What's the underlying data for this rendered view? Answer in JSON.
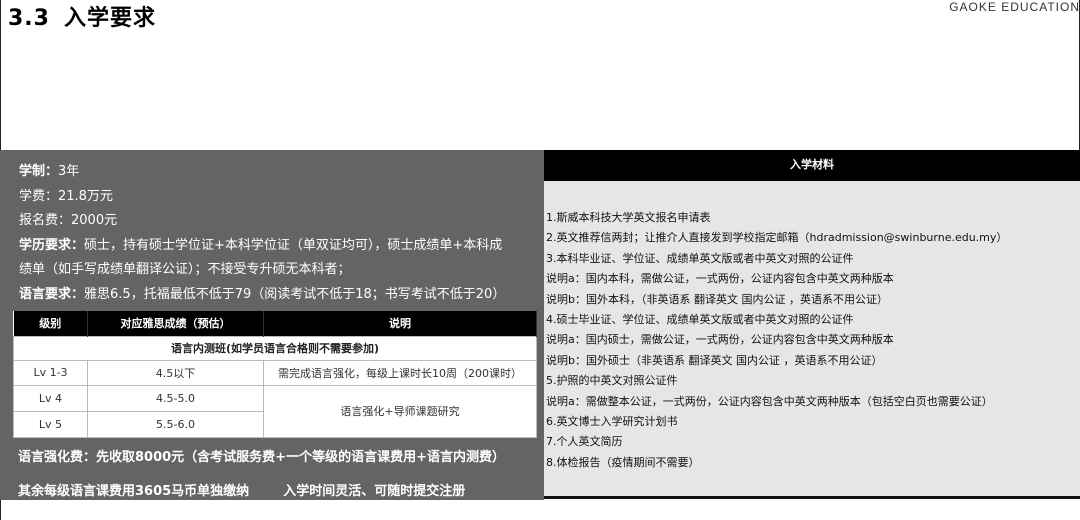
{
  "header": {
    "section_number": "3.3",
    "section_title": "入学要求",
    "brand": "GAOKE EDUCATION"
  },
  "left": {
    "duration_label": "学制：",
    "duration_value": "3年",
    "tuition": "学费：21.8万元",
    "application_fee": "报名费：2000元",
    "education_label": "学历要求：",
    "education_value_1": "硕士，持有硕士学位证+本科学位证（单双证均可），硕士成绩单+本科成",
    "education_value_2": "绩单（如手写成绩单翻译公证）；不接受专升硕无本科者；",
    "language_label": "语言要求：",
    "language_value": "雅思6.5，托福最低不低于79（阅读考试不低于18；书写考试不低于20）",
    "fee_line": "语言强化费：先收取8000元（含考试服务费+一个等级的语言课费用+语言内测费）",
    "other_fee": "其余每级语言课费用3605马币单独缴纳",
    "entry_time": "入学时间灵活、可随时提交注册"
  },
  "lang_table": {
    "caption": "语言内测班(如学员语言合格则不需要参加)",
    "headers": [
      "级别",
      "对应雅思成绩（预估）",
      "说明"
    ],
    "rows": [
      {
        "level": "Lv 1-3",
        "score": "4.5以下",
        "note": "需完成语言强化，每级上课时长10周（200课时）"
      },
      {
        "level": "Lv 4",
        "score": "4.5-5.0",
        "note": "语言强化+导师课题研究"
      },
      {
        "level": "Lv 5",
        "score": "5.5-6.0",
        "note": ""
      }
    ]
  },
  "right": {
    "title": "入学材料",
    "items": [
      "1.斯威本科技大学英文报名申请表",
      "2.英文推荐信两封；让推介人直接发到学校指定邮箱（hdradmission@swinburne.edu.my）",
      "3.本科毕业证、学位证、成绩单英文版或者中英文对照的公证件",
      "说明a：国内本科，需做公证，一式两份，公证内容包含中英文两种版本",
      "说明b：国外本科，（非英语系 翻译英文 国内公证 ，英语系不用公证）",
      "4.硕士毕业证、学位证、成绩单英文版或者中英文对照的公证件",
      "说明a：国内硕士，需做公证，一式两份，公证内容包含中英文两种版本",
      "说明b：国外硕士（非英语系 翻译英文 国内公证 ，英语系不用公证）",
      "5.护照的中英文对照公证件",
      "说明a：需做整本公证，一式两份，公证内容包含中英文两种版本（包括空白页也需要公证）",
      "6.英文博士入学研究计划书",
      "7.个人英文简历",
      "8.体检报告（疫情期间不需要）"
    ]
  }
}
